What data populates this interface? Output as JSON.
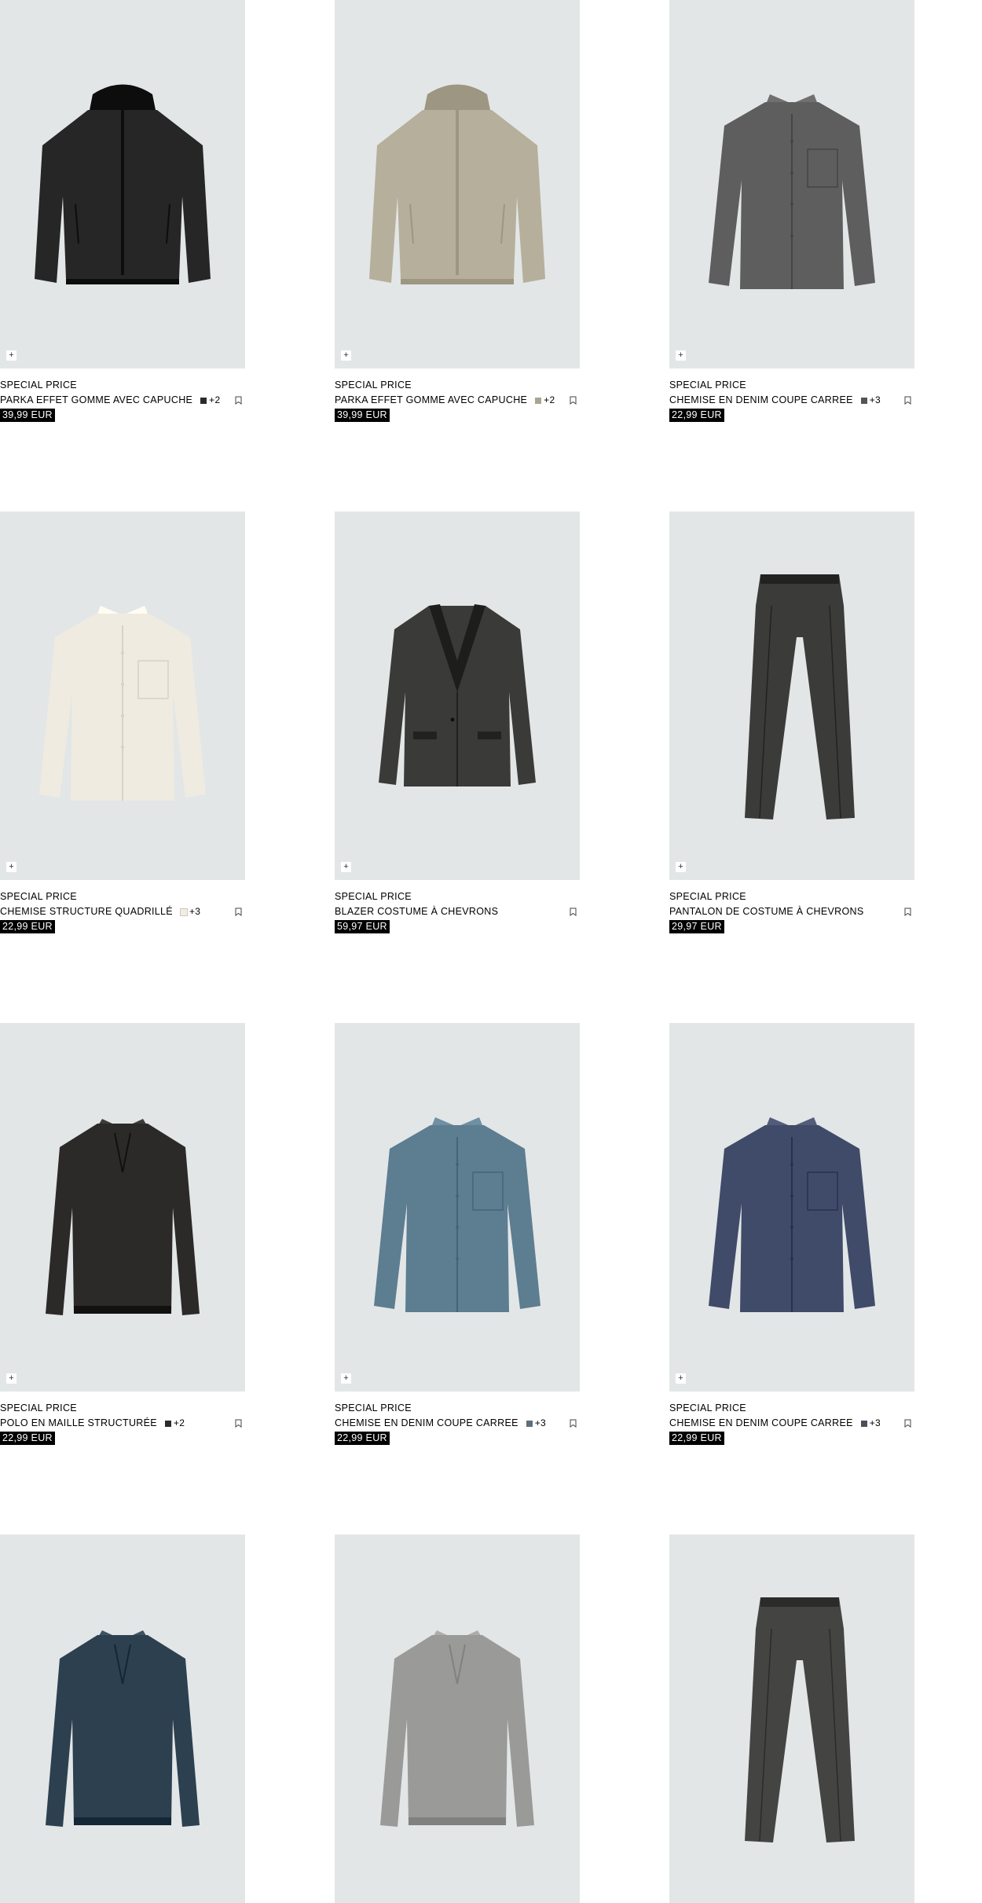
{
  "products": [
    {
      "label": "SPECIAL PRICE",
      "name": "PARKA EFFET GOMME AVEC CAPUCHE",
      "swatch": "#2b2b2b",
      "swatch_border": false,
      "more": "+2",
      "price": "39,99 EUR",
      "garment": "parka",
      "garment_color": "#262626",
      "icon": "plus-icon"
    },
    {
      "label": "SPECIAL PRICE",
      "name": "PARKA EFFET GOMME AVEC CAPUCHE",
      "swatch": "#a9a392",
      "swatch_border": false,
      "more": "+2",
      "price": "39,99 EUR",
      "garment": "parka",
      "garment_color": "#b6af9b",
      "icon": "plus-icon"
    },
    {
      "label": "SPECIAL PRICE",
      "name": "CHEMISE EN DENIM COUPE CARREE",
      "swatch": "#555555",
      "swatch_border": false,
      "more": "+3",
      "price": "22,99 EUR",
      "garment": "shirt",
      "garment_color": "#5e5e5e",
      "icon": "plus-icon"
    },
    {
      "label": "SPECIAL PRICE",
      "name": "CHEMISE STRUCTURE QUADRILLÉ",
      "swatch": "#f1ede4",
      "swatch_border": true,
      "more": "+3",
      "price": "22,99 EUR",
      "garment": "shirt",
      "garment_color": "#efebe1",
      "icon": "plus-icon"
    },
    {
      "label": "SPECIAL PRICE",
      "name": "BLAZER COSTUME À CHEVRONS",
      "swatch": "",
      "swatch_border": false,
      "more": "",
      "price": "59,97 EUR",
      "garment": "blazer",
      "garment_color": "#3a3a38",
      "icon": "plus-icon"
    },
    {
      "label": "SPECIAL PRICE",
      "name": "PANTALON DE COSTUME À CHEVRONS",
      "swatch": "",
      "swatch_border": false,
      "more": "",
      "price": "29,97 EUR",
      "garment": "trousers",
      "garment_color": "#3b3b39",
      "icon": "plus-icon"
    },
    {
      "label": "SPECIAL PRICE",
      "name": "POLO EN MAILLE STRUCTURÉE",
      "swatch": "#2d2b2a",
      "swatch_border": false,
      "more": "+2",
      "price": "22,99 EUR",
      "garment": "polo",
      "garment_color": "#2c2a29",
      "icon": "plus-icon"
    },
    {
      "label": "SPECIAL PRICE",
      "name": "CHEMISE EN DENIM COUPE CARREE",
      "swatch": "#5b6f7c",
      "swatch_border": false,
      "more": "+3",
      "price": "22,99 EUR",
      "garment": "shirt",
      "garment_color": "#5d7d91",
      "icon": "plus-icon"
    },
    {
      "label": "SPECIAL PRICE",
      "name": "CHEMISE EN DENIM COUPE CARREE",
      "swatch": "#4a4f5c",
      "swatch_border": false,
      "more": "+3",
      "price": "22,99 EUR",
      "garment": "shirt",
      "garment_color": "#3f4b68",
      "icon": "plus-icon"
    },
    {
      "garment": "polo",
      "garment_color": "#2c4050"
    },
    {
      "garment": "polo",
      "garment_color": "#9a9a98"
    },
    {
      "garment": "trousers",
      "garment_color": "#444442"
    }
  ],
  "icons": {
    "add": "plus-icon",
    "wishlist": "bookmark-icon"
  },
  "colors": {
    "image_background": "#e3e6e7",
    "price_background": "#000000",
    "price_text": "#ffffff"
  }
}
